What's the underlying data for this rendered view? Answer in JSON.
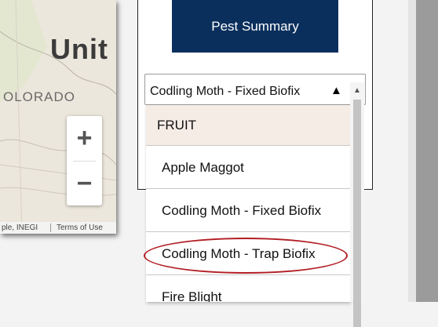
{
  "map": {
    "country_label": "Unit",
    "state_label": "OLORADO",
    "zoom_in_label": "+",
    "zoom_out_label": "−",
    "attribution_left": "ple, INEGI",
    "attribution_terms": "Terms of Use"
  },
  "pest_summary_button": "Pest Summary",
  "select": {
    "value": "Codling Moth - Fixed Biofix",
    "caret": "▲"
  },
  "dropdown": {
    "options": [
      {
        "label": "FRUIT"
      },
      {
        "label": "Apple Maggot"
      },
      {
        "label": "Codling Moth - Fixed Biofix"
      },
      {
        "label": "Codling Moth - Trap Biofix"
      },
      {
        "label": "Fire Blight"
      }
    ],
    "scroll_up": "▲"
  },
  "colors": {
    "button_bg": "#0b2f5c",
    "highlight": "#b21e24",
    "group_bg": "#f6ece6"
  }
}
